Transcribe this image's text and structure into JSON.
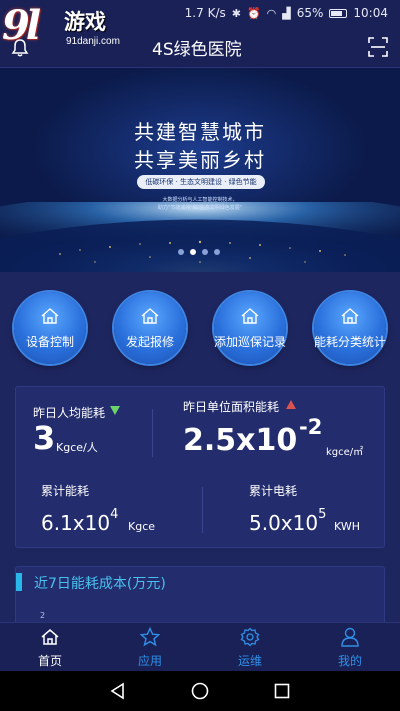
{
  "status_bar": {
    "speed": "1.7 K/s",
    "battery": "65%",
    "time": "10:04",
    "icons": [
      "bluetooth-icon",
      "alarm-icon",
      "wifi-icon",
      "signal-icon",
      "battery-icon"
    ]
  },
  "watermark": {
    "logo_text": "9l",
    "brand": "游戏",
    "url": "91danji.com"
  },
  "header": {
    "title": "4S绿色医院",
    "left_icon": "bell-icon",
    "right_icon": "scan-icon"
  },
  "banner": {
    "line1": "共建智慧城市",
    "line2": "共享美丽乡村",
    "tagline": "低碳环保 · 生态文明建设 · 绿色节能",
    "small_line1": "大数据分析与人工智能控制技术，",
    "small_line2": "助力\"节能减排\"和\"生态文明绿色发展\"",
    "page_count": 4,
    "active_page": 2
  },
  "quick_menu": [
    {
      "label": "设备控制",
      "icon": "home-icon"
    },
    {
      "label": "发起报修",
      "icon": "home-icon"
    },
    {
      "label": "添加巡保记录",
      "icon": "home-icon"
    },
    {
      "label": "能耗分类统计",
      "icon": "home-icon"
    }
  ],
  "stats": {
    "per_capita": {
      "label": "昨日人均能耗",
      "value": "3",
      "unit": "Kgce/人",
      "trend": "down"
    },
    "per_area": {
      "label": "昨日单位面积能耗",
      "mantissa": "2.5x10",
      "exponent": "-2",
      "unit": "kgce/㎡",
      "trend": "up"
    },
    "total_energy": {
      "label": "累计能耗",
      "mantissa": "6.1x10",
      "exponent": "4",
      "unit": "Kgce"
    },
    "total_power": {
      "label": "累计电耗",
      "mantissa": "5.0x10",
      "exponent": "5",
      "unit": "KWH"
    },
    "colors": {
      "down": "#6ad46b",
      "up": "#d9534f"
    }
  },
  "cost_section": {
    "title": "近7日能耗成本(万元)",
    "first_tick": "2"
  },
  "bottom_nav": [
    {
      "label": "首页",
      "icon": "home-icon",
      "active": true
    },
    {
      "label": "应用",
      "icon": "star-icon",
      "active": false
    },
    {
      "label": "运维",
      "icon": "gear-icon",
      "active": false
    },
    {
      "label": "我的",
      "icon": "user-icon",
      "active": false
    }
  ],
  "theme": {
    "background": "#1e2660",
    "accent": "#49c1ee",
    "nav_inactive": "#2f8fe6"
  }
}
